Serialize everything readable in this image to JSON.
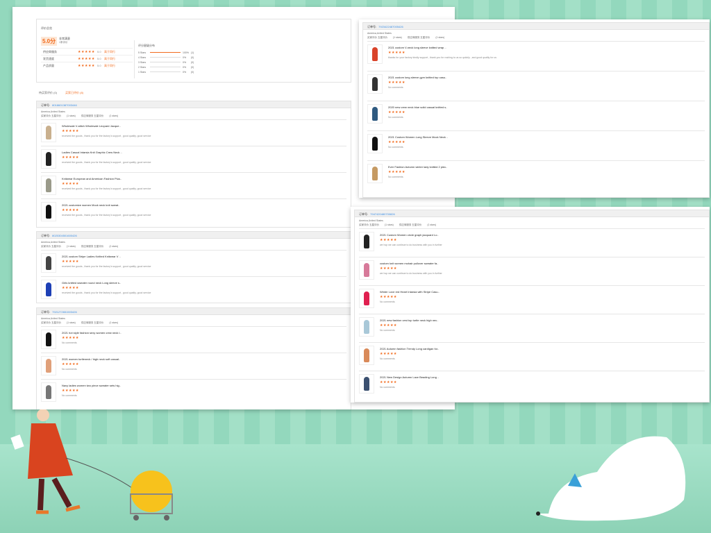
{
  "summary": {
    "title": "评价总览",
    "score": "5.0分",
    "satisfaction": "非常满意",
    "count": "1条评价",
    "metrics": [
      {
        "label": "供应商服务",
        "stars": "★★★★★",
        "value": "5.0",
        "compare": "高于同行"
      },
      {
        "label": "发货速度",
        "stars": "★★★★★",
        "value": "5.0",
        "compare": "高于同行"
      },
      {
        "label": "产品质量",
        "stars": "★★★★★",
        "value": "5.0",
        "compare": "高于同行"
      }
    ],
    "dist_title": "评分星级分布",
    "dist": [
      {
        "label": "5 Stars",
        "pct": 100,
        "pct_label": "100%",
        "n": "(1)"
      },
      {
        "label": "4 Stars",
        "pct": 0,
        "pct_label": "0%",
        "n": "(0)"
      },
      {
        "label": "3 Stars",
        "pct": 0,
        "pct_label": "0%",
        "n": "(0)"
      },
      {
        "label": "2 Stars",
        "pct": 0,
        "pct_label": "0%",
        "n": "(0)"
      },
      {
        "label": "1 Stars",
        "pct": 0,
        "pct_label": "0%",
        "n": "(0)"
      }
    ]
  },
  "tabs": [
    {
      "label": "待买家评价 (0)"
    },
    {
      "label": "买家已评价 (8)"
    }
  ],
  "orders": [
    {
      "label": "订单号:",
      "no": "8018601387003446",
      "country": "America,United States",
      "m1": "买家评价  五星评价",
      "m1c": "(1 stars)",
      "m2": "供应商服务  五星评价",
      "m2c": "(1 stars)",
      "items": [
        {
          "title": "Wholesale V-stitch Wholesale Leopard Jacque..",
          "comment": "received the goods , thank you for the factory's support , good quality, good service",
          "color": "#c9b08e"
        },
        {
          "title": "Ladies Casual Intarsia Knit Graphic Crew Neck ..",
          "comment": "received the goods , thank you for the factory's support , good quality, good service",
          "color": "#222"
        },
        {
          "title": "Knitwear European and American Fashion Plus..",
          "comment": "received the goods , thank you for the factory's support , good quality, good service",
          "color": "#9a9a8a"
        },
        {
          "title": "2021 customize women Mock neck knit sweat..",
          "comment": "received the goods , thank you for the factory's support , good quality, good service",
          "color": "#111"
        }
      ]
    },
    {
      "label": "订单号:",
      "no": "8020304501600426",
      "country": "America,United States",
      "m1": "买家评价  五星评价",
      "m1c": "(1 stars)",
      "m2": "供应商服务  五星评价",
      "m2c": "(1 stars)",
      "items": [
        {
          "title": "2021 custom Stripe Ladies Knitted Knitwear V ..",
          "comment": "received the goods , thank you for the factory's support , good quality, good service",
          "color": "#444"
        },
        {
          "title": "Girls knitted sweater round neck Long sleeve s..",
          "comment": "received the goods , thank you for the factory's support , good quality, good service",
          "color": "#1d3fb5"
        }
      ]
    },
    {
      "label": "订单号:",
      "no": "7921272651503426",
      "country": "America,United States",
      "m1": "买家评价  五星评价",
      "m1c": "(1 stars)",
      "m2": "供应商服务  五星评价",
      "m2c": "(1 stars)",
      "items": [
        {
          "title": "2021 hot style fashion sexy women crew neck l..",
          "comment": "No comments",
          "color": "#111"
        },
        {
          "title": "2021 women turtleneck / high neck soft casual..",
          "comment": "No comments",
          "color": "#e0a07a"
        },
        {
          "title": "Navy ladies women two piece sweater sets hig..",
          "comment": "No comments",
          "color": "#777"
        }
      ]
    },
    {
      "label": "订单号:",
      "no": "7923422487005426",
      "country": "America,United States",
      "m1": "买家评价  五星评价",
      "m1c": "(1 stars)",
      "m2": "供应商服务  五星评价",
      "m2c": "(1 stars)",
      "items": [
        {
          "title": "2021 custom V-neck long sleeve knitted wrap ..",
          "comment": "thanks for your factory kindly support , thank you for rushing to us so quickly , and good quality for us",
          "color": "#d9432a"
        },
        {
          "title": "2021 custom long sleeve gym knitted top casu..",
          "comment": "No comments",
          "color": "#333"
        },
        {
          "title": "2020 new crew neck blue solid casual knitted s..",
          "comment": "No comments",
          "color": "#2f5a80"
        },
        {
          "title": "2021 Custom Women Long Sleeve Mock Neck ..",
          "comment": "No comments",
          "color": "#111"
        },
        {
          "title": "Ever Fashion Autumn winter lady knitted 2 piec..",
          "comment": "No comments",
          "color": "#c59a63"
        }
      ]
    },
    {
      "label": "订单号:",
      "no": "7947420480700826",
      "country": "America,United States",
      "m1": "买家评价  五星评价",
      "m1c": "(1 stars)",
      "m2": "供应商服务  五星评价",
      "m2c": "(1 stars)",
      "items": [
        {
          "title": "2021 Custom Women circle graph jacquard Lo..",
          "comment": "we hop we can continue to do business with you in further",
          "color": "#222"
        },
        {
          "title": "custom knit women mohair pullover sweater fa..",
          "comment": "we hop we can continue to do business with you in further",
          "color": "#d77a9a"
        },
        {
          "title": "Winter Love red Heart Intarsia with Stripe Casu..",
          "comment": "No comments",
          "color": "#e02050"
        },
        {
          "title": "2021 new fashion vest top turtle neck high nec..",
          "comment": "No comments",
          "color": "#a9c8d8"
        },
        {
          "title": "2021 Autumn fashion Trendy Long cardigan for..",
          "comment": "No comments",
          "color": "#d98a5a"
        },
        {
          "title": "2021 New Design Autumn Lace Beading Long ..",
          "comment": "No comments",
          "color": "#3b5070"
        }
      ]
    }
  ],
  "colors": {
    "accent": "#f26b1d",
    "link": "#3a8ee6"
  }
}
